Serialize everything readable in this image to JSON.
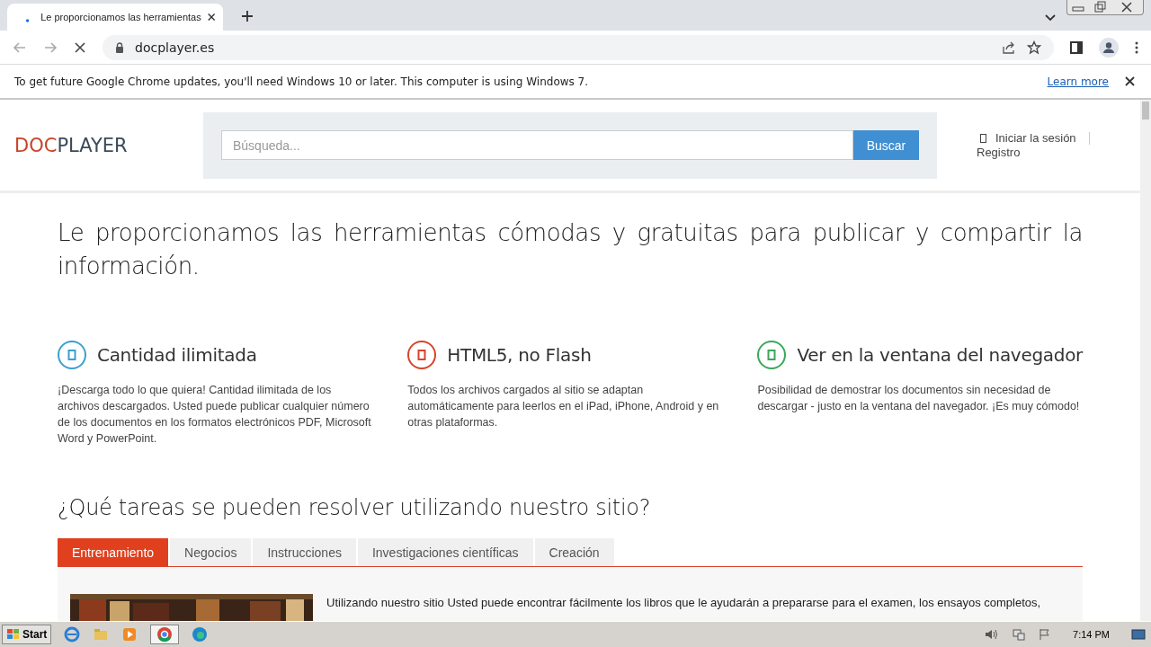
{
  "browser": {
    "tab": {
      "title": "Le proporcionamos las herramientas"
    },
    "url": "docplayer.es",
    "infobar": {
      "text": "To get future Google Chrome updates, you'll need Windows 10 or later. This computer is using Windows 7.",
      "link": "Learn more"
    }
  },
  "site": {
    "logo": [
      "DOC",
      "PLAYER"
    ],
    "search": {
      "placeholder": "Búsqueda..."
    },
    "search_button": "Buscar",
    "login": "Iniciar la sesión",
    "register": "Registro"
  },
  "headline": "Le proporcionamos las herramientas cómodas y gratuitas para publicar y compartir la información.",
  "features": [
    {
      "title": "Cantidad ilimitada",
      "text": "¡Descarga todo lo que quiera! Cantidad ilimitada de los archivos descargados. Usted puede publicar cualquier número de los documentos en los formatos electrónicos PDF, Microsoft Word y PowerPoint.",
      "color": "#3aa0d0"
    },
    {
      "title": "HTML5, no Flash",
      "text": "Todos los archivos cargados al sitio se adaptan automáticamente para leerlos en el iPad, iPhone, Android y en otras plataformas.",
      "color": "#d9432a"
    },
    {
      "title": "Ver en la ventana del navegador",
      "text": "Posibilidad de demostrar los documentos sin necesidad de descargar - justo en la ventana del navegador. ¡Es muy cómodo!",
      "color": "#3aa85a"
    }
  ],
  "question": "¿Qué tareas se pueden resolver utilizando nuestro sitio?",
  "tabs": [
    {
      "label": "Entrenamiento",
      "selected": true
    },
    {
      "label": "Negocios",
      "selected": false
    },
    {
      "label": "Instrucciones",
      "selected": false
    },
    {
      "label": "Investigaciones científicas",
      "selected": false
    },
    {
      "label": "Creación",
      "selected": false
    }
  ],
  "content": {
    "text": "Utilizando nuestro sitio Usted puede encontrar fácilmente los libros que le ayudarán a prepararse para el examen, los ensayos completos,"
  },
  "taskbar": {
    "start": "Start",
    "clock": "7:14 PM"
  }
}
